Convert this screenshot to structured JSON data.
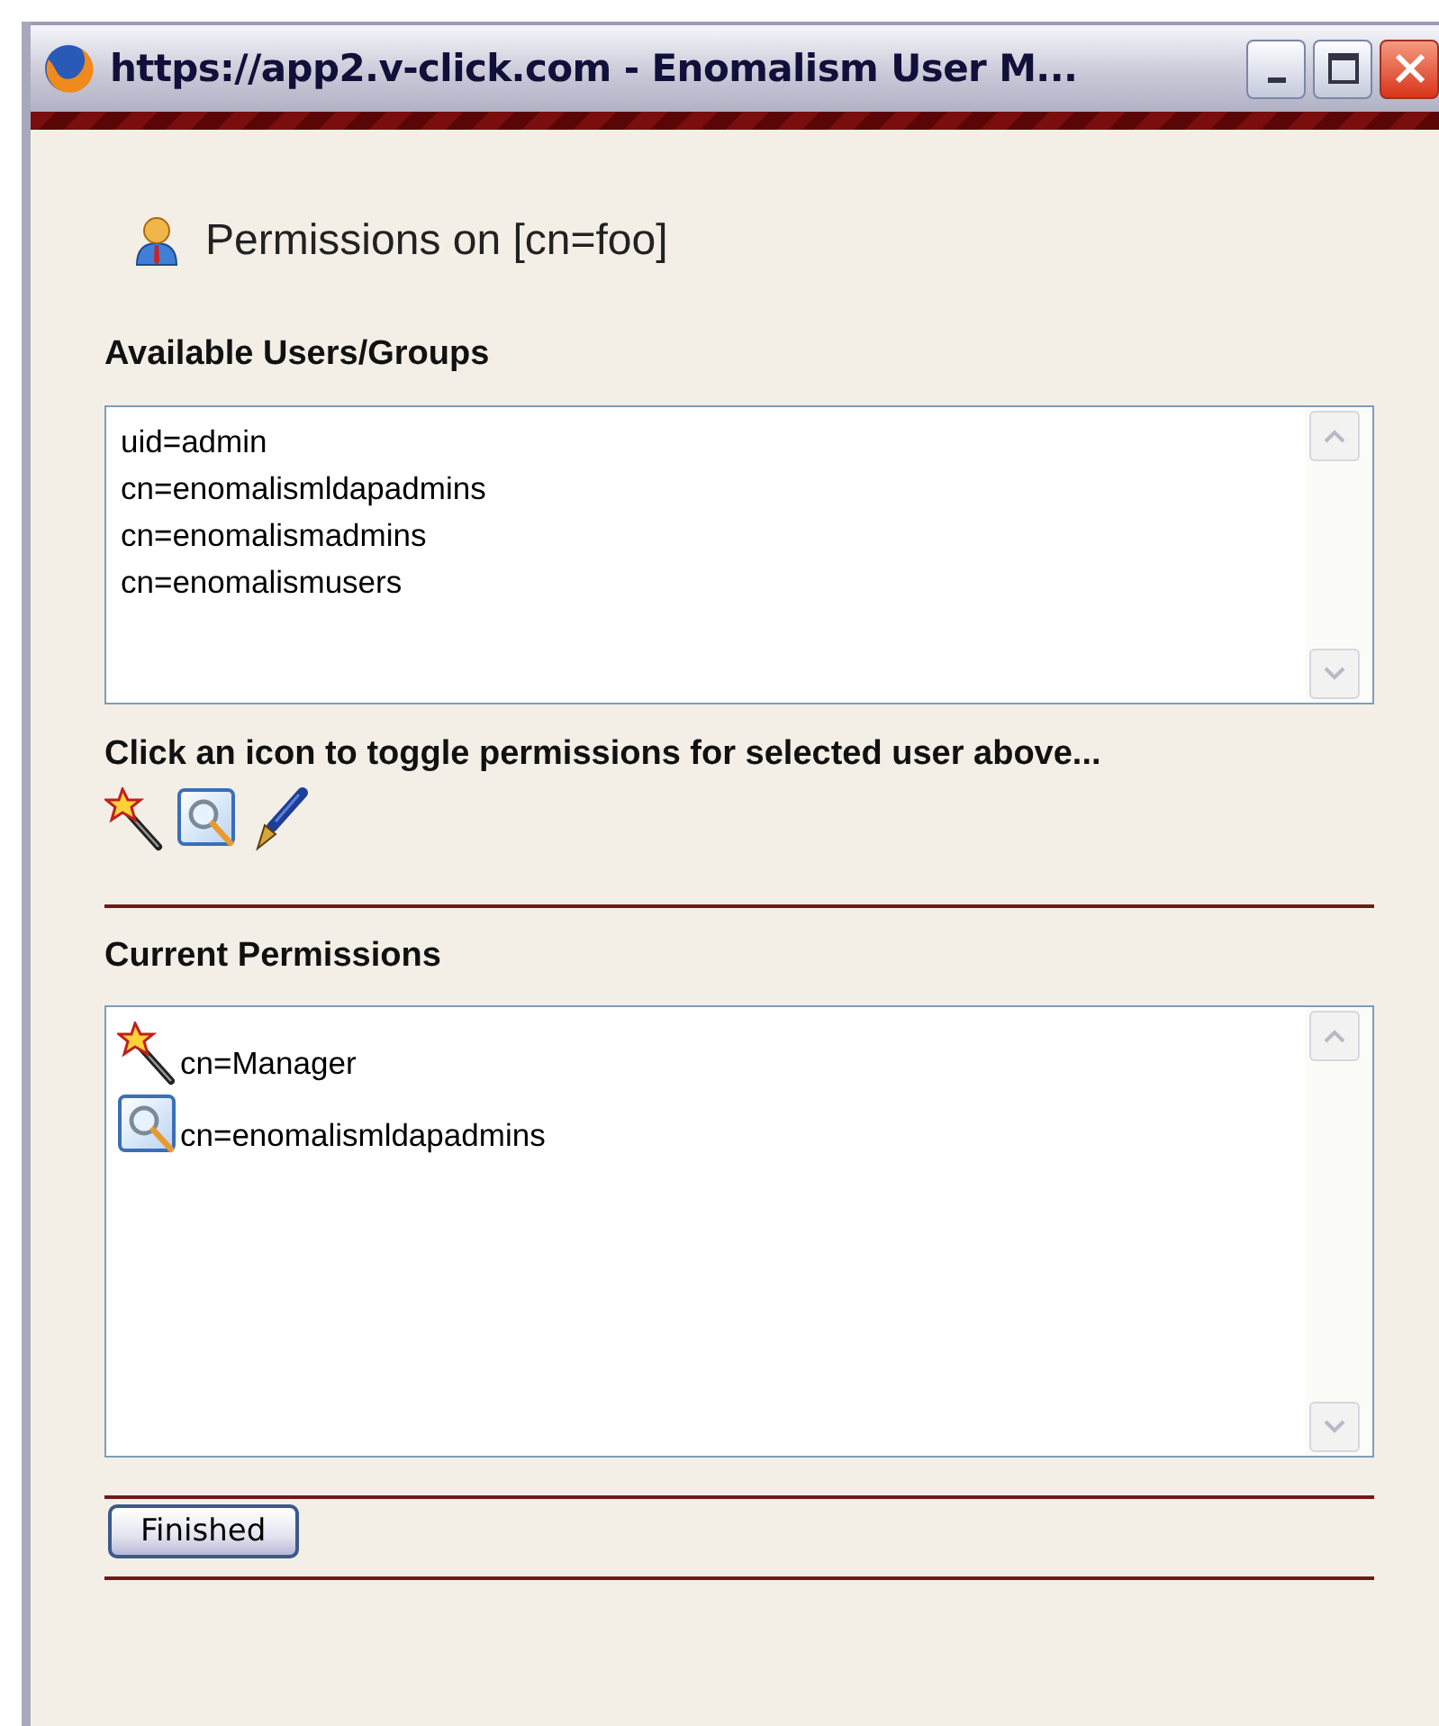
{
  "window": {
    "title": "https://app2.v-click.com - Enomalism User M..."
  },
  "heading": "Permissions on [cn=foo]",
  "available": {
    "label": "Available Users/Groups",
    "items": [
      {
        "text": "uid=admin",
        "selected": false
      },
      {
        "text": "cn=enomalismldapadmins",
        "selected": false
      },
      {
        "text": "cn=enomalismadmins",
        "selected": false
      },
      {
        "text": "cn=enomalismusers",
        "selected": false
      }
    ]
  },
  "instruction": "Click an icon to toggle permissions for selected user above...",
  "current": {
    "label": "Current Permissions",
    "items": [
      {
        "kind": "wand",
        "text": "cn=Manager"
      },
      {
        "kind": "lens",
        "text": "cn=enomalismldapadmins"
      }
    ]
  },
  "buttons": [
    "Finished"
  ]
}
